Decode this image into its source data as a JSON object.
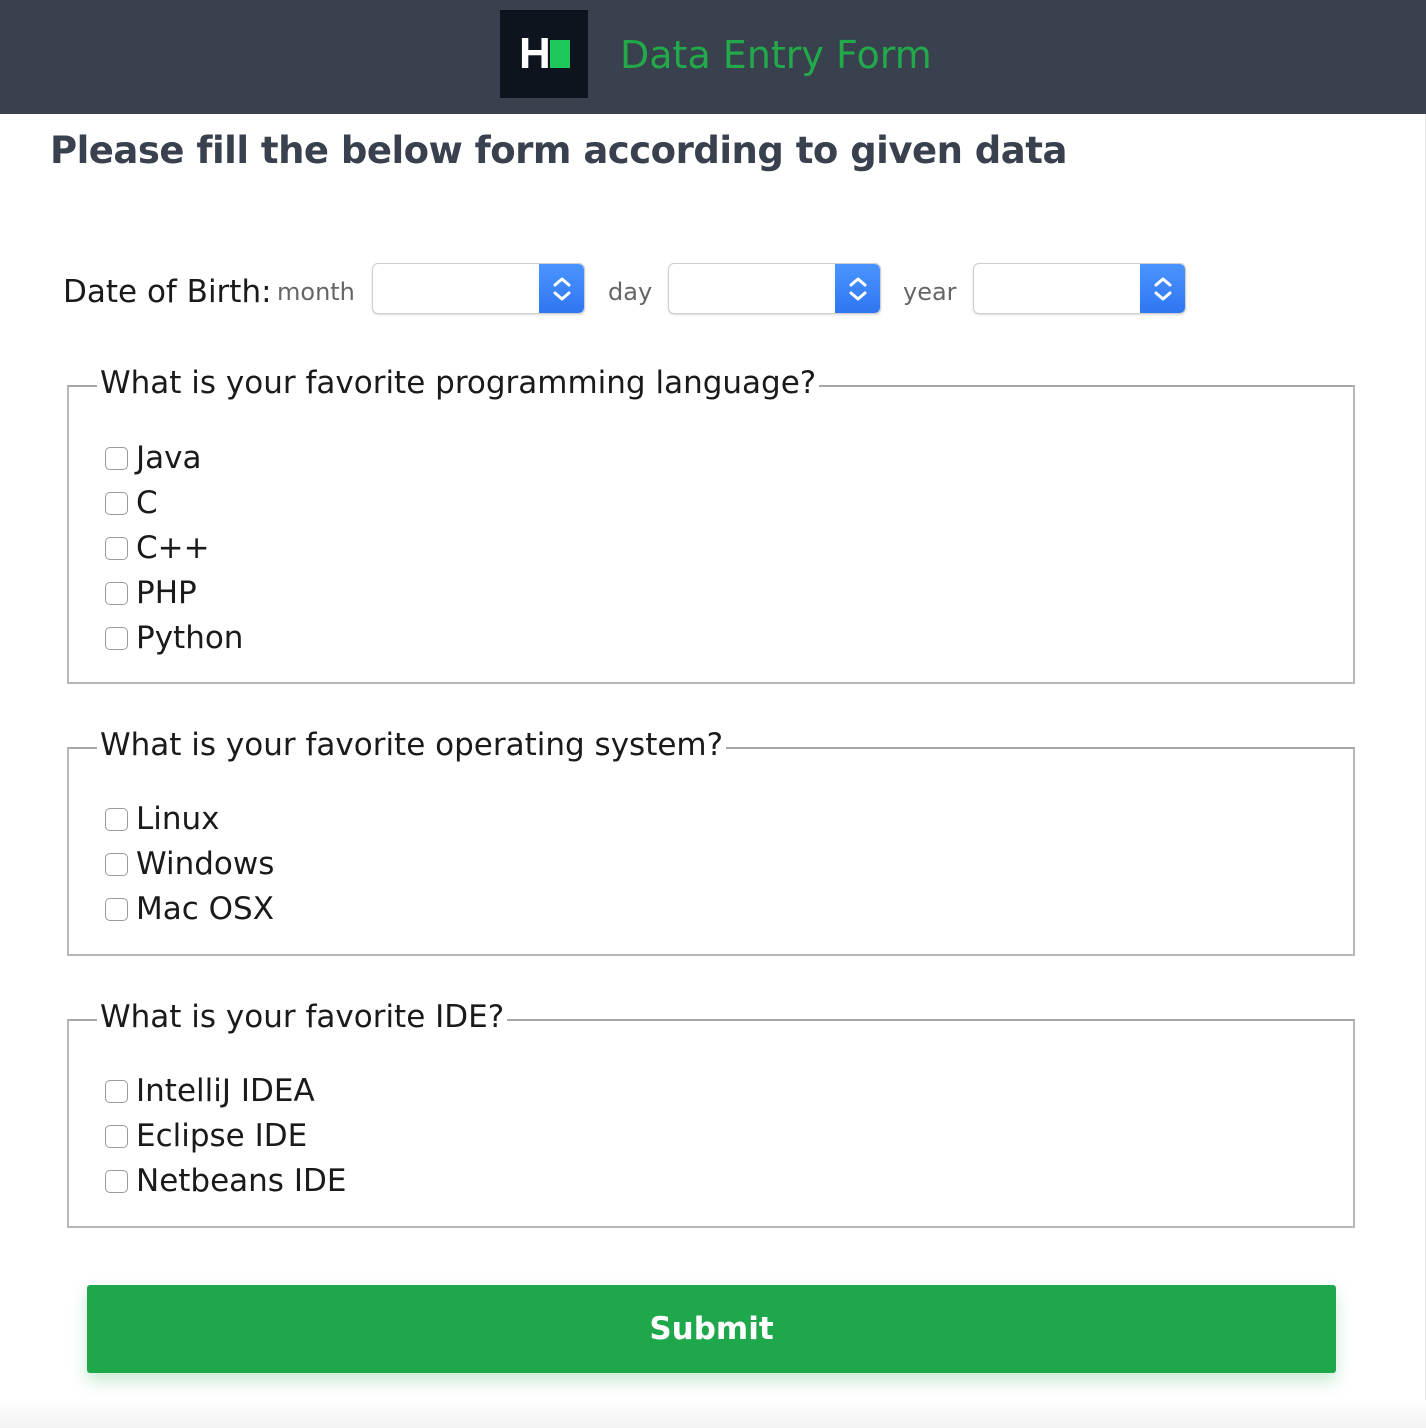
{
  "header": {
    "logo_text": "H",
    "title": "Data Entry Form"
  },
  "heading": "Please fill the below form according to given data",
  "dob": {
    "label": "Date of Birth:",
    "month_label": "month",
    "day_label": "day",
    "year_label": "year",
    "month_value": "",
    "day_value": "",
    "year_value": ""
  },
  "languages": {
    "legend": "What is your favorite programming language?",
    "options": [
      {
        "label": "Java",
        "checked": false
      },
      {
        "label": "C",
        "checked": false
      },
      {
        "label": "C++",
        "checked": false
      },
      {
        "label": "PHP",
        "checked": false
      },
      {
        "label": "Python",
        "checked": false
      }
    ]
  },
  "os": {
    "legend": "What is your favorite operating system?",
    "options": [
      {
        "label": "Linux",
        "checked": false
      },
      {
        "label": "Windows",
        "checked": false
      },
      {
        "label": "Mac OSX",
        "checked": false
      }
    ]
  },
  "ide": {
    "legend": "What is your favorite IDE?",
    "options": [
      {
        "label": "IntelliJ IDEA",
        "checked": false
      },
      {
        "label": "Eclipse IDE",
        "checked": false
      },
      {
        "label": "Netbeans IDE",
        "checked": false
      }
    ]
  },
  "submit_label": "Submit",
  "colors": {
    "header_bg": "#39404e",
    "accent_green": "#1ea84b",
    "select_arrow_blue": "#2f76f0"
  }
}
